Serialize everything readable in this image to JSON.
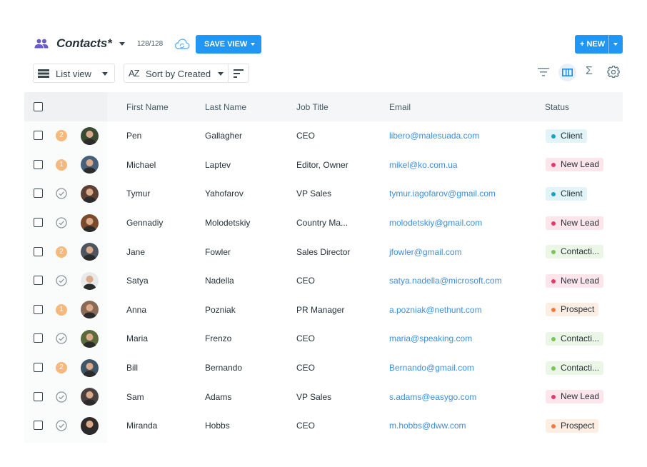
{
  "header": {
    "title": "Contacts*",
    "count": "128/128",
    "save_view_label": "SAVE VIEW",
    "new_label": "+ NEW"
  },
  "toolbar": {
    "view_mode": "List view",
    "sort_icon_text": "AZ",
    "sort_label": "Sort by Created",
    "sum_symbol": "Σ"
  },
  "table": {
    "columns": [
      "First Name",
      "Last Name",
      "Job Title",
      "Email",
      "Status"
    ],
    "rows": [
      {
        "badge": "2",
        "first": "Pen",
        "last": "Gallagher",
        "job": "CEO",
        "email": "libero@malesuada.com",
        "status": "Client",
        "avatar_bg": "#3b4a32"
      },
      {
        "badge": "1",
        "first": "Michael",
        "last": "Laptev",
        "job": "Editor, Owner",
        "email": "mikel@ko.com.ua",
        "status": "New Lead",
        "avatar_bg": "#46607a"
      },
      {
        "badge": "",
        "first": "Tymur",
        "last": "Yahofarov",
        "job": "VP Sales",
        "email": "tymur.iagofarov@gmail.com",
        "status": "Client",
        "avatar_bg": "#5d4035"
      },
      {
        "badge": "",
        "first": "Gennadiy",
        "last": "Molodetskiy",
        "job": "Country Ma...",
        "email": "molodetskiy@gmail.com",
        "status": "New Lead",
        "avatar_bg": "#7a4a2c"
      },
      {
        "badge": "2",
        "first": "Jane",
        "last": "Fowler",
        "job": "Sales Director",
        "email": "jfowler@gmail.com",
        "status": "Contacti...",
        "avatar_bg": "#4c5560"
      },
      {
        "badge": "",
        "first": "Satya",
        "last": "Nadella",
        "job": "CEO",
        "email": "satya.nadella@microsoft.com",
        "status": "New Lead",
        "avatar_bg": "#e9e9e9"
      },
      {
        "badge": "1",
        "first": "Anna",
        "last": "Pozniak",
        "job": "PR Manager",
        "email": "a.pozniak@nethunt.com",
        "status": "Prospect",
        "avatar_bg": "#8a6a55"
      },
      {
        "badge": "",
        "first": "Maria",
        "last": "Frenzo",
        "job": "CEO",
        "email": "maria@speaking.com",
        "status": "Contacti...",
        "avatar_bg": "#5a6a3a"
      },
      {
        "badge": "2",
        "first": "Bill",
        "last": "Bernando",
        "job": "CEO",
        "email": "Bernando@gmail.com",
        "status": "Contacti...",
        "avatar_bg": "#3e5566"
      },
      {
        "badge": "",
        "first": "Sam",
        "last": "Adams",
        "job": "VP Sales",
        "email": "s.adams@easygo.com",
        "status": "New Lead",
        "avatar_bg": "#4a4040"
      },
      {
        "badge": "",
        "first": "Miranda",
        "last": "Hobbs",
        "job": "CEO",
        "email": "m.hobbs@dww.com",
        "status": "Prospect",
        "avatar_bg": "#2e2a2a"
      }
    ]
  },
  "status_styles": {
    "Client": {
      "bg": "#e2f4f7",
      "dot": "#1aa1c4"
    },
    "New Lead": {
      "bg": "#fce6ec",
      "dot": "#e5396a"
    },
    "Contacti...": {
      "bg": "#ecf6e6",
      "dot": "#7cc35a"
    },
    "Prospect": {
      "bg": "#fdeee4",
      "dot": "#f07a40"
    }
  },
  "colors": {
    "accent": "#2196f3",
    "badge": "#f5b97e",
    "link": "#3d8fdf",
    "contacts_icon": "#6a5acd"
  }
}
